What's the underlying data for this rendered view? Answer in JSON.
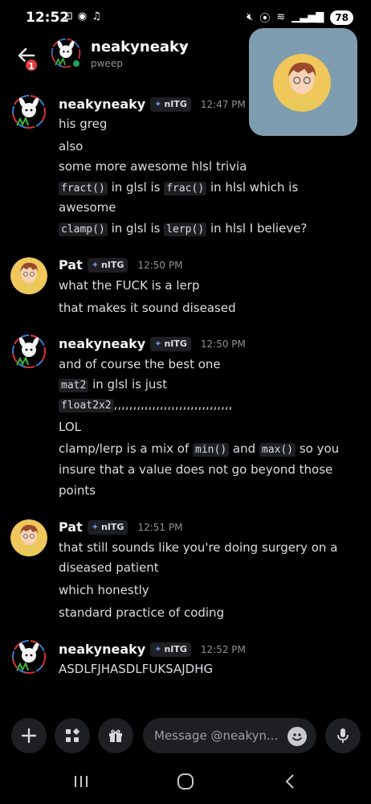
{
  "status_bar": {
    "time": "12:52",
    "battery": "78"
  },
  "header": {
    "back_badge": "1",
    "name": "neakyneaky",
    "chevron": "›",
    "subtitle": "pweep"
  },
  "messages": [
    {
      "author": "neakyneaky",
      "tag": "nITG",
      "time": "12:47 PM",
      "lines": [
        {
          "parts": [
            {
              "t": "his greg"
            }
          ]
        },
        {
          "parts": [
            {
              "t": "also"
            }
          ]
        },
        {
          "parts": [
            {
              "t": "some more awesome hlsl trivia"
            }
          ]
        },
        {
          "parts": [
            {
              "c": "fract()"
            },
            {
              "t": " in glsl is "
            },
            {
              "c": "frac()"
            },
            {
              "t": " in hlsl which is"
            }
          ]
        },
        {
          "parts": [
            {
              "t": "awesome"
            }
          ]
        },
        {
          "parts": [
            {
              "c": "clamp()"
            },
            {
              "t": " in glsl is "
            },
            {
              "c": "lerp()"
            },
            {
              "t": " in hlsl I believe?"
            }
          ]
        }
      ]
    },
    {
      "author": "Pat",
      "tag": "nITG",
      "time": "12:50 PM",
      "lines": [
        {
          "parts": [
            {
              "t": "what the FUCK is a lerp"
            }
          ]
        },
        {
          "parts": [
            {
              "t": "that makes it sound diseased"
            }
          ]
        }
      ]
    },
    {
      "author": "neakyneaky",
      "tag": "nITG",
      "time": "12:50 PM",
      "lines": [
        {
          "parts": [
            {
              "t": "and of course the best one"
            }
          ]
        },
        {
          "parts": [
            {
              "c": "mat2"
            },
            {
              "t": " in glsl is just"
            }
          ]
        },
        {
          "parts": [
            {
              "c": "float2x2"
            },
            {
              "t": ",,,,,,,,,,,,,,,,,,,,,,,,,,,,,,,"
            }
          ]
        },
        {
          "parts": [
            {
              "t": "LOL"
            }
          ]
        },
        {
          "parts": [
            {
              "t": "clamp/lerp is a mix of "
            },
            {
              "c": "min()"
            },
            {
              "t": " and "
            },
            {
              "c": "max()"
            },
            {
              "t": " so you"
            }
          ]
        },
        {
          "parts": [
            {
              "t": "insure that a value does not go beyond those"
            }
          ]
        },
        {
          "parts": [
            {
              "t": "points"
            }
          ]
        }
      ]
    },
    {
      "author": "Pat",
      "tag": "nITG",
      "time": "12:51 PM",
      "lines": [
        {
          "parts": [
            {
              "t": "that still sounds like you're doing surgery on a"
            }
          ]
        },
        {
          "parts": [
            {
              "t": "diseased patient"
            }
          ]
        },
        {
          "parts": [
            {
              "t": "which honestly"
            }
          ]
        },
        {
          "parts": [
            {
              "t": "standard practice of coding"
            }
          ]
        }
      ]
    },
    {
      "author": "neakyneaky",
      "tag": "nITG",
      "time": "12:52 PM",
      "lines": [
        {
          "parts": [
            {
              "t": "ASDLFJHASDLFUKSAJDHG"
            }
          ]
        }
      ]
    }
  ],
  "input": {
    "placeholder": "Message @neakyn..."
  },
  "colors": {
    "background": "#000000",
    "online": "#23a55a",
    "badge": "#e23b41",
    "call_tile": "#7f9db0",
    "tag_icon": "#7289da"
  }
}
